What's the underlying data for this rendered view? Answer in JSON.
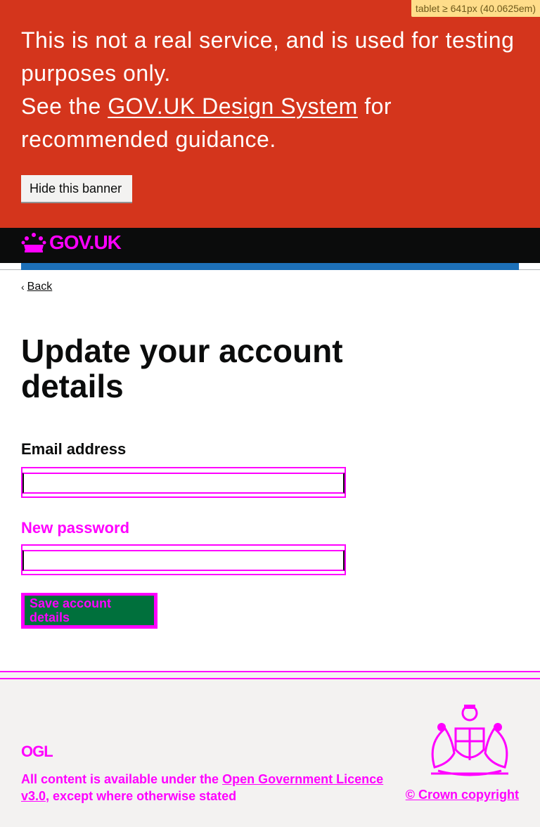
{
  "breakpoint": "tablet ≥ 641px (40.0625em)",
  "banner": {
    "line1": "This is not a real service, and is used for testing purposes only.",
    "line2_prefix": "See the ",
    "link": "GOV.UK Design System",
    "line2_suffix": " for recommended guidance.",
    "hide_button": "Hide this banner"
  },
  "header": {
    "logo": "GOV.UK"
  },
  "back": {
    "label": "Back"
  },
  "page": {
    "title": "Update your account details",
    "email_label": "Email address",
    "email_value": "",
    "password_label": "New password",
    "password_value": "",
    "save_button": "Save account details"
  },
  "footer": {
    "ogl": "OGL",
    "licence_prefix": "All content is available under the ",
    "licence_link": "Open Government Licence v3.0",
    "licence_suffix": ", except where otherwise stated",
    "copyright": "© Crown copyright"
  },
  "colors": {
    "banner": "#d4351c",
    "header": "#0b0c0c",
    "accent_bar": "#1d70b8",
    "button": "#00703c",
    "footer": "#f3f2f1",
    "highlight": "#ff00ff"
  }
}
